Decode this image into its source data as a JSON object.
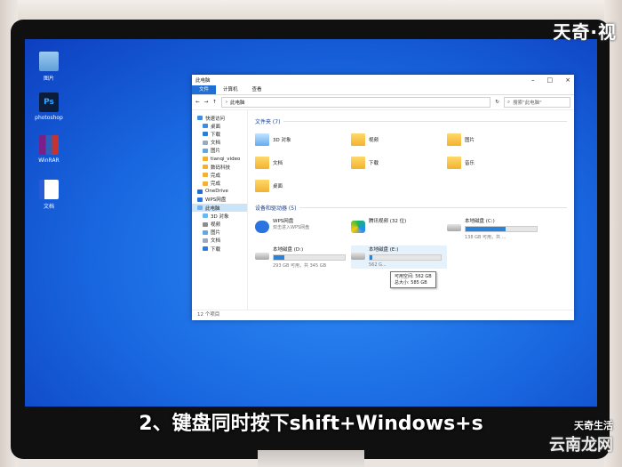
{
  "branding": {
    "top_right": "天奇·视",
    "bottom_right_small": "天奇生活",
    "bottom_right_large": "云南龙网"
  },
  "caption": "2、键盘同时按下shift+Windows+s",
  "desktop_icons": [
    {
      "label": "图片",
      "icon": "computer-icon"
    },
    {
      "label": "photoshop",
      "icon": "photoshop-icon"
    },
    {
      "label": "WinRAR",
      "icon": "winrar-icon"
    },
    {
      "label": "文档",
      "icon": "document-icon"
    }
  ],
  "window": {
    "title": "此电脑",
    "ribbon_tabs": [
      "文件",
      "计算机",
      "查看"
    ],
    "address": "此电脑",
    "search_placeholder": "搜索\"此电脑\"",
    "nav": [
      {
        "label": "快速访问",
        "sub": false
      },
      {
        "label": "桌面",
        "sub": true
      },
      {
        "label": "下载",
        "sub": true
      },
      {
        "label": "文档",
        "sub": true
      },
      {
        "label": "图片",
        "sub": true
      },
      {
        "label": "tianqi_video",
        "sub": true
      },
      {
        "label": "数码科技",
        "sub": true
      },
      {
        "label": "完成",
        "sub": true
      },
      {
        "label": "完成",
        "sub": true
      },
      {
        "label": "OneDrive",
        "sub": false
      },
      {
        "label": "WPS网盘",
        "sub": false
      },
      {
        "label": "此电脑",
        "sub": false
      },
      {
        "label": "3D 对象",
        "sub": true
      },
      {
        "label": "视频",
        "sub": true
      },
      {
        "label": "图片",
        "sub": true
      },
      {
        "label": "文档",
        "sub": true
      },
      {
        "label": "下载",
        "sub": true
      }
    ],
    "folders_header": "文件夹 (7)",
    "folders": [
      "3D 对象",
      "视频",
      "图片",
      "文档",
      "下载",
      "音乐",
      "桌面"
    ],
    "drives_header": "设备和驱动器 (5)",
    "drives": [
      {
        "name": "WPS网盘",
        "sub": "双击进入WPS网盘",
        "icon": "cloud-icon"
      },
      {
        "name": "腾讯视频 (32 位)",
        "sub": "",
        "icon": "tencent-video-icon"
      },
      {
        "name": "本地磁盘 (C:)",
        "sub": "138 GB 可用，共 ...",
        "usage": 0.56,
        "icon": "hdd-icon"
      },
      {
        "name": "本地磁盘 (D:)",
        "sub": "293 GB 可用，共 345 GB",
        "usage": 0.15,
        "icon": "hdd-icon"
      },
      {
        "name": "本地磁盘 (E:)",
        "sub": "562 G...",
        "usage": 0.04,
        "icon": "hdd-icon"
      }
    ],
    "tooltip": {
      "line1": "可用空间: 562 GB",
      "line2": "总大小: 585 GB"
    },
    "status": "12 个项目"
  }
}
